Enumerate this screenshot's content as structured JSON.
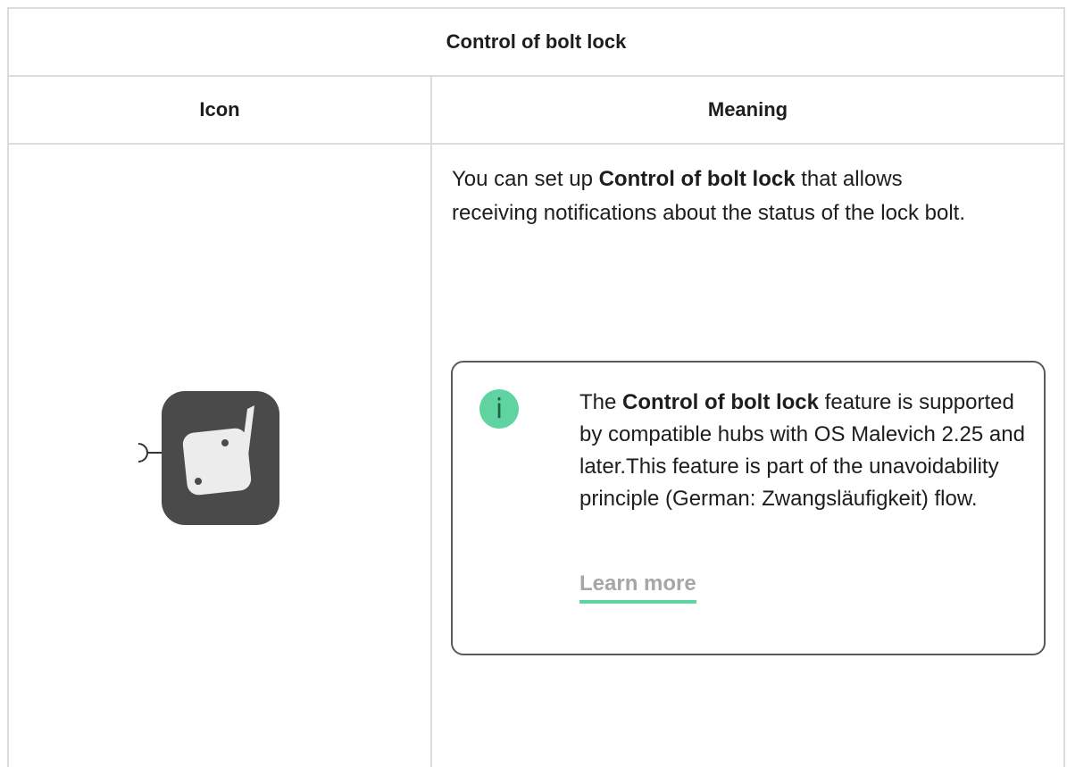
{
  "table": {
    "title": "Control of bolt lock",
    "headers": {
      "icon": "Icon",
      "meaning": "Meaning"
    },
    "row": {
      "icon_name": "bolt-lock-control-icon",
      "description": {
        "prefix": "You can set up ",
        "bold": "Control of bolt lock",
        "suffix": " that allows receiving notifications about the status of the lock bolt."
      },
      "note": {
        "badge": "i",
        "prefix": "The ",
        "bold": "Control of bolt lock",
        "suffix": " feature is supported by compatible hubs with OS Malevich 2.25 and later.This feature is part of the unavoidability principle (German: Zwangsläufigkeit) flow.",
        "link_label": "Learn more"
      }
    }
  },
  "colors": {
    "accent": "#5fd3a0",
    "icon_bg": "#4a4a4a",
    "border": "#dcdcdc"
  }
}
